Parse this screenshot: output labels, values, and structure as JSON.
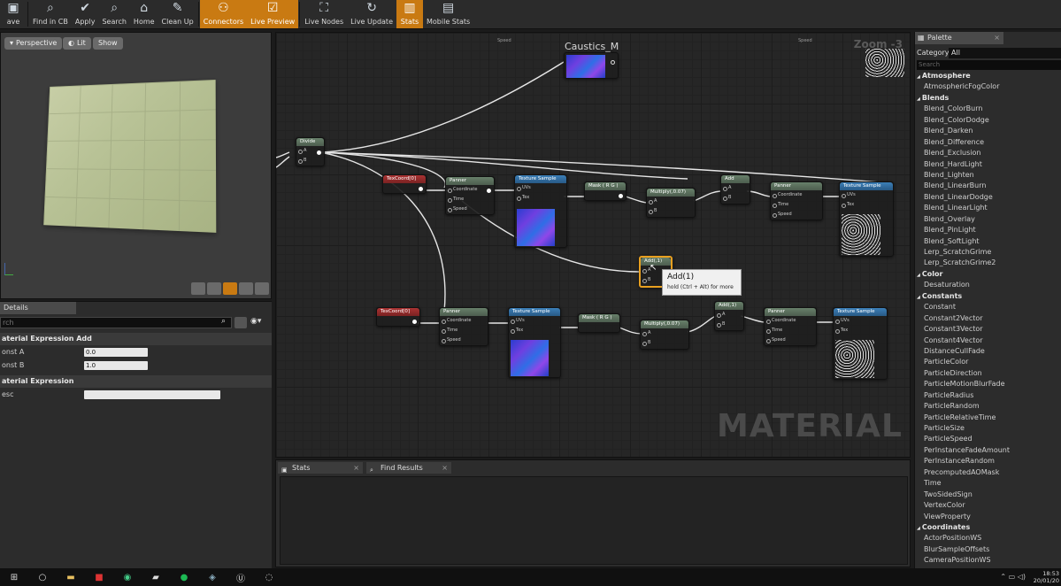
{
  "toolbar": {
    "buttons": [
      {
        "label": "ave",
        "icon": "save-icon",
        "active": false
      },
      {
        "label": "Find in CB",
        "icon": "find-icon",
        "active": false
      },
      {
        "label": "Apply",
        "icon": "check-icon",
        "active": false
      },
      {
        "label": "Search",
        "icon": "search-icon",
        "active": false
      },
      {
        "label": "Home",
        "icon": "home-icon",
        "active": false
      },
      {
        "label": "Clean Up",
        "icon": "broom-icon",
        "active": false
      },
      {
        "label": "Connectors",
        "icon": "connectors-icon",
        "active": true
      },
      {
        "label": "Live Preview",
        "icon": "checkbox-icon",
        "active": true
      },
      {
        "label": "Live Nodes",
        "icon": "nodes-icon",
        "active": false
      },
      {
        "label": "Live Update",
        "icon": "refresh-icon",
        "active": false
      },
      {
        "label": "Stats",
        "icon": "stats-icon",
        "active": true
      },
      {
        "label": "Mobile Stats",
        "icon": "mobile-stats-icon",
        "active": false
      }
    ]
  },
  "viewport": {
    "perspective_label": "Perspective",
    "lit_label": "Lit",
    "show_label": "Show"
  },
  "details": {
    "tab_label": "Details",
    "search_placeholder": "rch",
    "section1": "aterial Expression Add",
    "const_a_label": "onst A",
    "const_a_value": "0.0",
    "const_b_label": "onst B",
    "const_b_value": "1.0",
    "section2": "aterial Expression",
    "desc_label": "esc",
    "desc_value": ""
  },
  "graph": {
    "top_label_left": "Speed",
    "top_label_right": "Speed",
    "caustics_title": "Caustics_M",
    "zoom_label": "Zoom -3",
    "watermark": "MATERIAL",
    "nodes": {
      "divide": "Divide",
      "texcoord1": "TexCoord[0]",
      "panner1": "Panner",
      "texsample1": "Texture Sample",
      "mask1": "Mask ( R G )",
      "multiply1": "Multiply(,0.07)",
      "add1": "Add",
      "panner2": "Panner",
      "texsample2": "Texture Sample",
      "add_selected": "Add(,1)",
      "texcoord2": "TexCoord[0]",
      "panner3": "Panner",
      "texsample3": "Texture Sample",
      "mask2": "Mask ( R G )",
      "multiply2": "Multiply(,0.07)",
      "add2": "Add(,1)",
      "panner4": "Panner",
      "texsample4": "Texture Sample"
    },
    "pins": {
      "a": "A",
      "b": "B",
      "coordinate": "Coordinate",
      "time": "Time",
      "speed": "Speed",
      "uvs": "UVs",
      "tex": "Tex"
    },
    "tooltip_title": "Add(1)",
    "tooltip_hint": "hold (Ctrl + Alt) for more"
  },
  "stats": {
    "tab_stats": "Stats",
    "tab_find": "Find Results"
  },
  "palette": {
    "tab_label": "Palette",
    "category_label": "Category:",
    "category_value": "All",
    "search_placeholder": "Search",
    "items": [
      {
        "label": "Atmosphere",
        "cat": true
      },
      {
        "label": "AtmosphericFogColor",
        "cat": false
      },
      {
        "label": "Blends",
        "cat": true
      },
      {
        "label": "Blend_ColorBurn",
        "cat": false
      },
      {
        "label": "Blend_ColorDodge",
        "cat": false
      },
      {
        "label": "Blend_Darken",
        "cat": false
      },
      {
        "label": "Blend_Difference",
        "cat": false
      },
      {
        "label": "Blend_Exclusion",
        "cat": false
      },
      {
        "label": "Blend_HardLight",
        "cat": false
      },
      {
        "label": "Blend_Lighten",
        "cat": false
      },
      {
        "label": "Blend_LinearBurn",
        "cat": false
      },
      {
        "label": "Blend_LinearDodge",
        "cat": false
      },
      {
        "label": "Blend_LinearLight",
        "cat": false
      },
      {
        "label": "Blend_Overlay",
        "cat": false
      },
      {
        "label": "Blend_PinLight",
        "cat": false
      },
      {
        "label": "Blend_SoftLight",
        "cat": false
      },
      {
        "label": "Lerp_ScratchGrime",
        "cat": false
      },
      {
        "label": "Lerp_ScratchGrime2",
        "cat": false
      },
      {
        "label": "Color",
        "cat": true
      },
      {
        "label": "Desaturation",
        "cat": false
      },
      {
        "label": "Constants",
        "cat": true
      },
      {
        "label": "Constant",
        "cat": false
      },
      {
        "label": "Constant2Vector",
        "cat": false
      },
      {
        "label": "Constant3Vector",
        "cat": false
      },
      {
        "label": "Constant4Vector",
        "cat": false
      },
      {
        "label": "DistanceCullFade",
        "cat": false
      },
      {
        "label": "ParticleColor",
        "cat": false
      },
      {
        "label": "ParticleDirection",
        "cat": false
      },
      {
        "label": "ParticleMotionBlurFade",
        "cat": false
      },
      {
        "label": "ParticleRadius",
        "cat": false
      },
      {
        "label": "ParticleRandom",
        "cat": false
      },
      {
        "label": "ParticleRelativeTime",
        "cat": false
      },
      {
        "label": "ParticleSize",
        "cat": false
      },
      {
        "label": "ParticleSpeed",
        "cat": false
      },
      {
        "label": "PerInstanceFadeAmount",
        "cat": false
      },
      {
        "label": "PerInstanceRandom",
        "cat": false
      },
      {
        "label": "PrecomputedAOMask",
        "cat": false
      },
      {
        "label": "Time",
        "cat": false
      },
      {
        "label": "TwoSidedSign",
        "cat": false
      },
      {
        "label": "VertexColor",
        "cat": false
      },
      {
        "label": "ViewProperty",
        "cat": false
      },
      {
        "label": "Coordinates",
        "cat": true
      },
      {
        "label": "ActorPositionWS",
        "cat": false
      },
      {
        "label": "BlurSampleOffsets",
        "cat": false
      },
      {
        "label": "CameraPositionWS",
        "cat": false
      }
    ]
  },
  "taskbar": {
    "time": "18:53",
    "date": "20/01/20"
  },
  "colors": {
    "accent": "#c97a12",
    "selection": "#e8a020"
  }
}
